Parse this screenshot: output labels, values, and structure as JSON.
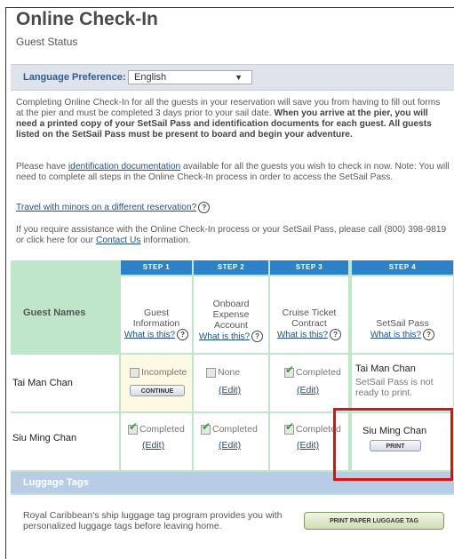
{
  "header": {
    "title": "Online Check-In",
    "guest_status": "Guest Status"
  },
  "language": {
    "label": "Language Preference:",
    "selected": "English"
  },
  "intro": {
    "p1_a": "Completing Online Check-In for all the guests in your reservation will save you from having to fill out forms at the pier and must be completed 3 days prior to your sail date. ",
    "p1_b": "When you arrive at the pier, you will need a printed copy of your SetSail Pass and identification documents for each guest. All guests listed on the SetSail Pass must be present to board and begin your adventure.",
    "p2_a": "Please have ",
    "p2_link": "identification documentation",
    "p2_b": " available for all the guests you wish to check in now. Note: You will need to complete all steps in the Online Check-In process in order to access the SetSail Pass.",
    "minors_link": "Travel with minors on a different reservation?",
    "p3_a": "If you require assistance with the Online Check-In process or your SetSail Pass, please call (800) 398-9819 or click here for our ",
    "p3_link": "Contact Us",
    "p3_b": " information."
  },
  "table": {
    "steps": [
      "STEP 1",
      "STEP 2",
      "STEP 3",
      "STEP 4"
    ],
    "guest_names_label": "Guest Names",
    "columns": [
      {
        "l1": "Guest",
        "l2": "Information",
        "what": "What is this?"
      },
      {
        "l1": "Onboard",
        "l2": "Expense",
        "l3": "Account",
        "what": "What is this?"
      },
      {
        "l1": "Cruise Ticket",
        "l2": "Contract",
        "what": "What is this?"
      },
      {
        "l1": "SetSail Pass",
        "what": "What is this?"
      }
    ],
    "rows": [
      {
        "name": "Tai Man Chan",
        "s1": {
          "status": "Incomplete",
          "button": "CONTINUE"
        },
        "s2": {
          "status": "None",
          "edit": "(Edit)"
        },
        "s3": {
          "status": "Completed",
          "edit": "(Edit)"
        },
        "s4": {
          "name": "Tai Man Chan",
          "note": "SetSail Pass is not ready to print."
        }
      },
      {
        "name": "Siu Ming Chan",
        "s1": {
          "status": "Completed",
          "edit": "(Edit)"
        },
        "s2": {
          "status": "Completed",
          "edit": "(Edit)"
        },
        "s3": {
          "status": "Completed",
          "edit": "(Edit)"
        },
        "s4": {
          "name": "Siu Ming Chan",
          "button": "PRINT"
        }
      }
    ]
  },
  "luggage": {
    "label": "Luggage Tags",
    "text": "Royal Caribbean's ship luggage tag program provides you with personalized luggage tags before leaving home.",
    "button": "PRINT PAPER LUGGAGE TAG"
  },
  "icons": {
    "help": "question-bubble-icon",
    "check": "checkmark-icon",
    "dropdown": "chevron-down-icon"
  },
  "colors": {
    "step_header": "#2b82c9",
    "grid_bg": "#bfe6c8",
    "highlight": "#e01010"
  }
}
